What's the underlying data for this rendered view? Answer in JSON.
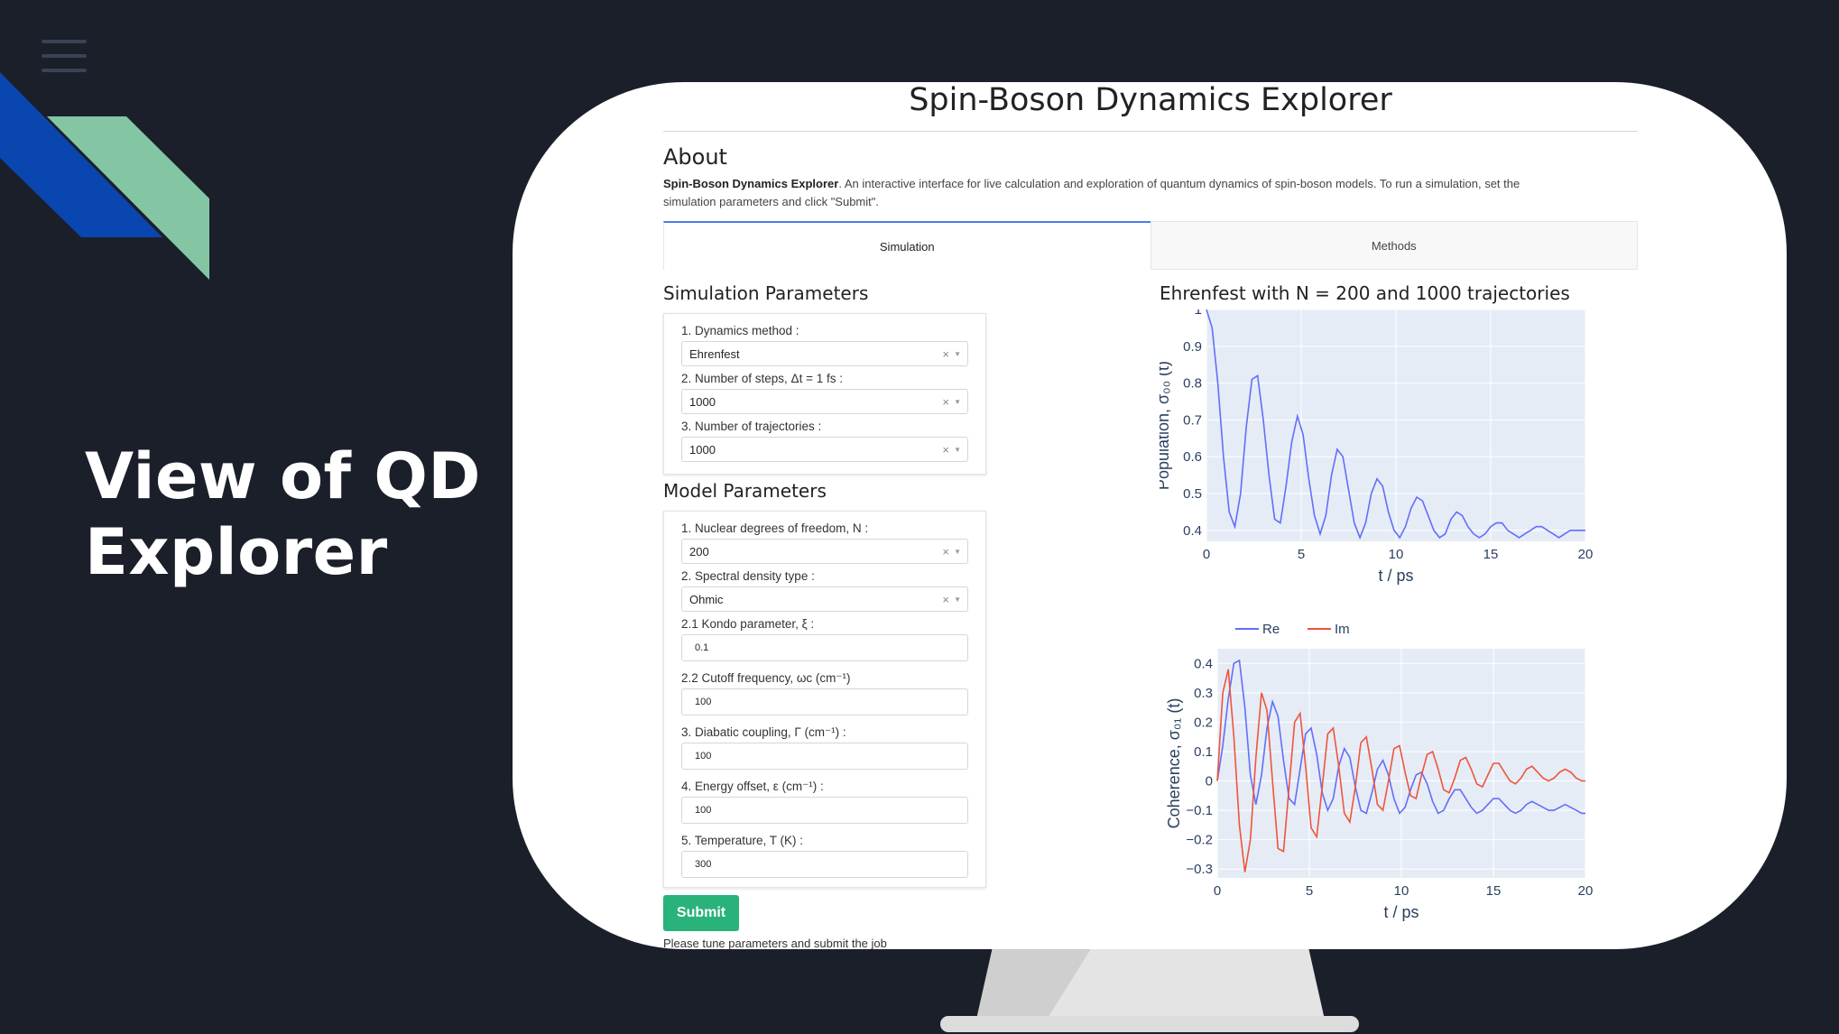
{
  "slide": {
    "title_line1": "View of QD",
    "title_line2": "Explorer",
    "accent_colors": [
      "#0a46b0",
      "#84c6a4"
    ]
  },
  "app": {
    "title": "Spin-Boson Dynamics Explorer",
    "about": {
      "heading": "About",
      "bold": "Spin-Boson Dynamics Explorer",
      "line1_rest": ". An interactive interface for live calculation and exploration of quantum dynamics of spin-boson models. To run a simulation, set the",
      "line2": "simulation parameters and click \"Submit\"."
    },
    "tabs": [
      {
        "label": "Simulation",
        "active": true
      },
      {
        "label": "Methods",
        "active": false
      }
    ],
    "simulation_parameters": {
      "heading": "Simulation Parameters",
      "fields": [
        {
          "label": "1. Dynamics method :",
          "value": "Ehrenfest"
        },
        {
          "label": "2. Number of steps, Δt = 1 fs :",
          "value": "1000"
        },
        {
          "label": "3. Number of trajectories :",
          "value": "1000"
        }
      ]
    },
    "model_parameters": {
      "heading": "Model Parameters",
      "dropdowns": [
        {
          "label": "1. Nuclear degrees of freedom, N :",
          "value": "200"
        },
        {
          "label": "2. Spectral density type :",
          "value": "Ohmic"
        }
      ],
      "inputs": [
        {
          "label": "2.1 Kondo parameter, ξ :",
          "value": "0.1"
        },
        {
          "label": "2.2 Cutoff frequency, ωc (cm⁻¹)",
          "value": "100"
        },
        {
          "label": "3. Diabatic coupling, Γ (cm⁻¹) :",
          "value": "100"
        },
        {
          "label": "4. Energy offset, ε (cm⁻¹) :",
          "value": "100"
        },
        {
          "label": "5. Temperature, T (K) :",
          "value": "300"
        }
      ]
    },
    "submit_label": "Submit",
    "status_text": "Please tune parameters and submit the job",
    "clear_symbol": "×",
    "caret_symbol": "▼"
  },
  "chart_data": [
    {
      "type": "line",
      "title": "Ehrenfest with N = 200 and 1000 trajectories",
      "xlabel": "t / ps",
      "ylabel": "Population, σ₀₀ (t)",
      "xlim": [
        0,
        20
      ],
      "ylim": [
        0.37,
        1.0
      ],
      "x_ticks": [
        0,
        5,
        10,
        15,
        20
      ],
      "y_ticks": [
        0.4,
        0.5,
        0.6,
        0.7,
        0.8,
        0.9,
        1
      ],
      "grid": true,
      "series": [
        {
          "color": "#636efa",
          "x": [
            0,
            0.3,
            0.6,
            0.9,
            1.2,
            1.5,
            1.8,
            2.1,
            2.4,
            2.7,
            3.0,
            3.3,
            3.6,
            3.9,
            4.2,
            4.5,
            4.8,
            5.1,
            5.4,
            5.7,
            6.0,
            6.3,
            6.6,
            6.9,
            7.2,
            7.5,
            7.8,
            8.1,
            8.4,
            8.7,
            9.0,
            9.3,
            9.6,
            9.9,
            10.2,
            10.5,
            10.8,
            11.1,
            11.4,
            11.7,
            12.0,
            12.3,
            12.6,
            12.9,
            13.2,
            13.5,
            13.8,
            14.1,
            14.4,
            14.7,
            15.0,
            15.3,
            15.6,
            15.9,
            16.2,
            16.5,
            16.8,
            17.1,
            17.4,
            17.7,
            18.0,
            18.3,
            18.6,
            18.9,
            19.2,
            19.5,
            19.8,
            20.0
          ],
          "y": [
            1.0,
            0.95,
            0.8,
            0.6,
            0.45,
            0.41,
            0.5,
            0.68,
            0.81,
            0.82,
            0.7,
            0.55,
            0.43,
            0.42,
            0.52,
            0.64,
            0.71,
            0.66,
            0.54,
            0.44,
            0.39,
            0.44,
            0.55,
            0.62,
            0.6,
            0.51,
            0.42,
            0.38,
            0.42,
            0.5,
            0.54,
            0.52,
            0.45,
            0.4,
            0.38,
            0.41,
            0.46,
            0.49,
            0.48,
            0.44,
            0.4,
            0.38,
            0.39,
            0.43,
            0.45,
            0.44,
            0.41,
            0.39,
            0.38,
            0.39,
            0.41,
            0.42,
            0.42,
            0.4,
            0.39,
            0.38,
            0.39,
            0.4,
            0.41,
            0.41,
            0.4,
            0.39,
            0.38,
            0.39,
            0.4,
            0.4,
            0.4,
            0.4
          ]
        }
      ]
    },
    {
      "type": "line",
      "xlabel": "t / ps",
      "ylabel": "Coherence, σ₀₁ (t)",
      "xlim": [
        0,
        20
      ],
      "ylim": [
        -0.33,
        0.45
      ],
      "x_ticks": [
        0,
        5,
        10,
        15,
        20
      ],
      "y_ticks": [
        -0.3,
        -0.2,
        -0.1,
        0,
        0.1,
        0.2,
        0.3,
        0.4
      ],
      "legend": "top",
      "grid": true,
      "series": [
        {
          "name": "Re",
          "color": "#636efa",
          "x": [
            0,
            0.3,
            0.6,
            0.9,
            1.2,
            1.5,
            1.8,
            2.1,
            2.4,
            2.7,
            3.0,
            3.3,
            3.6,
            3.9,
            4.2,
            4.5,
            4.8,
            5.1,
            5.4,
            5.7,
            6.0,
            6.3,
            6.6,
            6.9,
            7.2,
            7.5,
            7.8,
            8.1,
            8.4,
            8.7,
            9.0,
            9.3,
            9.6,
            9.9,
            10.2,
            10.5,
            10.8,
            11.1,
            11.4,
            11.7,
            12.0,
            12.3,
            12.6,
            12.9,
            13.2,
            13.5,
            13.8,
            14.1,
            14.4,
            14.7,
            15.0,
            15.3,
            15.6,
            15.9,
            16.2,
            16.5,
            16.8,
            17.1,
            17.4,
            17.7,
            18.0,
            18.3,
            18.6,
            18.9,
            19.2,
            19.5,
            19.8,
            20.0
          ],
          "y": [
            0.0,
            0.12,
            0.28,
            0.4,
            0.41,
            0.25,
            0.02,
            -0.08,
            0.02,
            0.18,
            0.27,
            0.22,
            0.07,
            -0.06,
            -0.08,
            0.04,
            0.16,
            0.18,
            0.09,
            -0.04,
            -0.1,
            -0.06,
            0.05,
            0.11,
            0.08,
            -0.02,
            -0.1,
            -0.11,
            -0.04,
            0.04,
            0.07,
            0.02,
            -0.06,
            -0.11,
            -0.09,
            -0.03,
            0.02,
            0.03,
            -0.01,
            -0.07,
            -0.11,
            -0.1,
            -0.06,
            -0.03,
            -0.03,
            -0.06,
            -0.09,
            -0.11,
            -0.1,
            -0.08,
            -0.06,
            -0.06,
            -0.08,
            -0.1,
            -0.11,
            -0.1,
            -0.08,
            -0.07,
            -0.08,
            -0.09,
            -0.1,
            -0.1,
            -0.09,
            -0.08,
            -0.09,
            -0.1,
            -0.11,
            -0.11
          ]
        },
        {
          "name": "Im",
          "color": "#ef553b",
          "x": [
            0,
            0.3,
            0.6,
            0.9,
            1.2,
            1.5,
            1.8,
            2.1,
            2.4,
            2.7,
            3.0,
            3.3,
            3.6,
            3.9,
            4.2,
            4.5,
            4.8,
            5.1,
            5.4,
            5.7,
            6.0,
            6.3,
            6.6,
            6.9,
            7.2,
            7.5,
            7.8,
            8.1,
            8.4,
            8.7,
            9.0,
            9.3,
            9.6,
            9.9,
            10.2,
            10.5,
            10.8,
            11.1,
            11.4,
            11.7,
            12.0,
            12.3,
            12.6,
            12.9,
            13.2,
            13.5,
            13.8,
            14.1,
            14.4,
            14.7,
            15.0,
            15.3,
            15.6,
            15.9,
            16.2,
            16.5,
            16.8,
            17.1,
            17.4,
            17.7,
            18.0,
            18.3,
            18.6,
            18.9,
            19.2,
            19.5,
            19.8,
            20.0
          ],
          "y": [
            0.0,
            0.3,
            0.38,
            0.15,
            -0.15,
            -0.31,
            -0.2,
            0.08,
            0.3,
            0.24,
            0.0,
            -0.23,
            -0.24,
            -0.02,
            0.2,
            0.23,
            0.05,
            -0.16,
            -0.19,
            -0.02,
            0.16,
            0.18,
            0.05,
            -0.11,
            -0.14,
            -0.02,
            0.13,
            0.15,
            0.04,
            -0.08,
            -0.1,
            0.0,
            0.11,
            0.12,
            0.03,
            -0.05,
            -0.06,
            0.02,
            0.09,
            0.1,
            0.04,
            -0.03,
            -0.04,
            0.01,
            0.07,
            0.08,
            0.04,
            -0.01,
            -0.02,
            0.02,
            0.06,
            0.06,
            0.03,
            0.0,
            -0.01,
            0.01,
            0.04,
            0.05,
            0.03,
            0.01,
            0.0,
            0.01,
            0.03,
            0.04,
            0.03,
            0.01,
            0.0,
            0.0
          ]
        }
      ]
    }
  ]
}
